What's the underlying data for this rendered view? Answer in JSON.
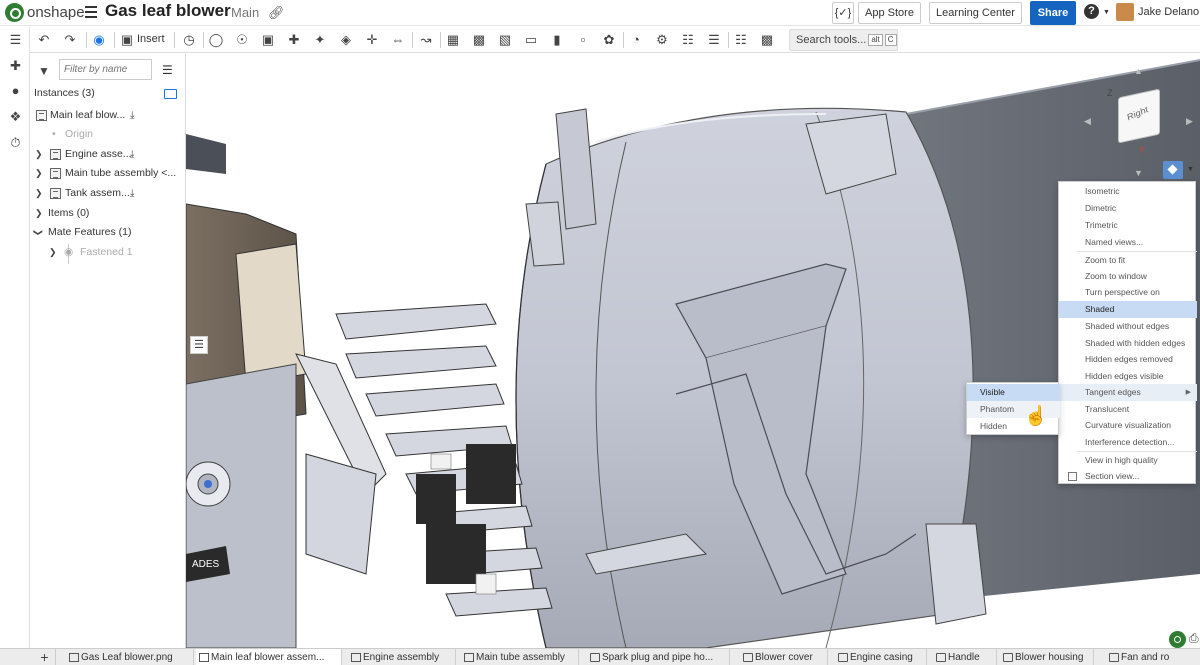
{
  "app": {
    "brand": "onshape",
    "document_title": "Gas leaf blower",
    "workspace": "Main",
    "link_icon": "link-icon",
    "menu_icon": "hamburger-icon"
  },
  "header": {
    "variables_btn": "{✓}",
    "app_store": "App Store",
    "learning_center": "Learning Center",
    "share": "Share",
    "help": "?",
    "user_name": "Jake Delano",
    "share_color": "#1565c0"
  },
  "toolbar": {
    "insert_label": "Insert",
    "search_placeholder": "Search tools...",
    "shortcut_alt": "alt",
    "shortcut_c": "C"
  },
  "panel": {
    "filter_placeholder": "Filter by name",
    "instances_header": "Instances (3)",
    "rows": [
      {
        "label": "Main leaf blow...",
        "type": "part"
      },
      {
        "label": "Origin",
        "type": "origin"
      },
      {
        "label": "Engine asse...",
        "type": "assembly"
      },
      {
        "label": "Main tube assembly <...",
        "type": "assembly"
      },
      {
        "label": "Tank assem...",
        "type": "assembly"
      }
    ],
    "items_header": "Items (0)",
    "mates_header": "Mate Features (1)",
    "mate_row": "Fastened 1"
  },
  "viewcube": {
    "face_label": "Right",
    "axis_z": "Z",
    "axis_y": "Y"
  },
  "view_menu": {
    "items": [
      "Isometric",
      "Dimetric",
      "Trimetric",
      "Named views...",
      "Zoom to fit",
      "Zoom to window",
      "Turn perspective on",
      "Shaded",
      "Shaded without edges",
      "Shaded with hidden edges",
      "Hidden edges removed",
      "Hidden edges visible",
      "Tangent edges",
      "Translucent",
      "Curvature visualization",
      "Interference detection...",
      "View in high quality",
      "Section view..."
    ],
    "selected": "Shaded",
    "highlighted": "Tangent edges"
  },
  "tangent_submenu": {
    "items": [
      "Visible",
      "Phantom",
      "Hidden"
    ],
    "selected": "Visible",
    "hovered": "Phantom"
  },
  "tabs": [
    {
      "label": "Gas Leaf blower.png",
      "icon": "image-icon"
    },
    {
      "label": "Main leaf blower assem...",
      "icon": "assembly-icon",
      "active": true
    },
    {
      "label": "Engine assembly",
      "icon": "assembly-icon"
    },
    {
      "label": "Main tube assembly",
      "icon": "assembly-icon"
    },
    {
      "label": "Spark plug and pipe ho...",
      "icon": "folder-icon"
    },
    {
      "label": "Blower cover",
      "icon": "folder-icon"
    },
    {
      "label": "Engine casing",
      "icon": "folder-icon"
    },
    {
      "label": "Handle",
      "icon": "folder-icon"
    },
    {
      "label": "Blower housing",
      "icon": "folder-icon"
    },
    {
      "label": "Fan and ro",
      "icon": "folder-icon"
    }
  ]
}
